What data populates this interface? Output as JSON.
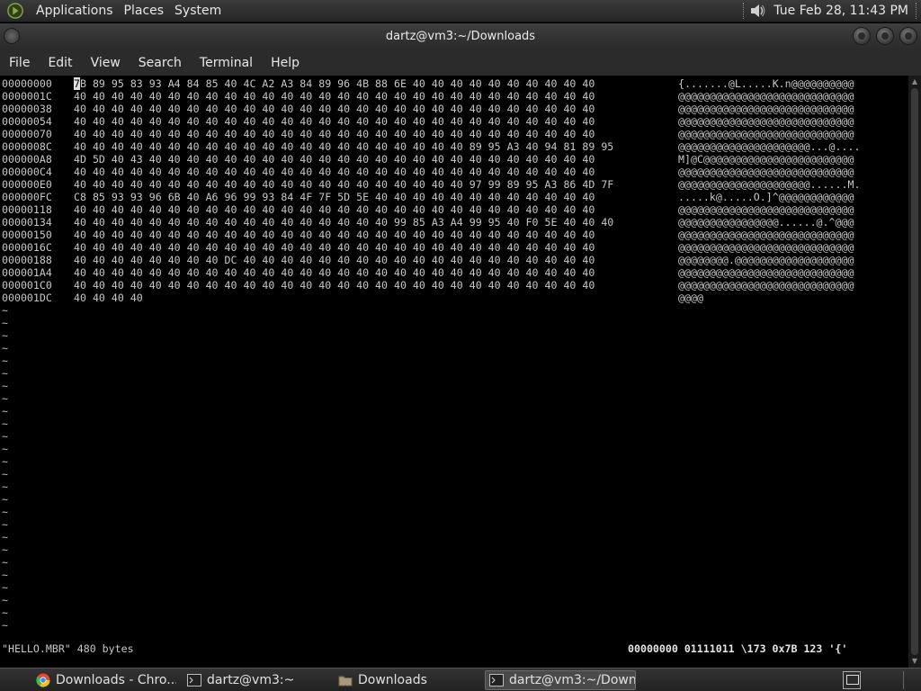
{
  "top_panel": {
    "menus": [
      "Applications",
      "Places",
      "System"
    ],
    "clock": "Tue Feb 28, 11:43 PM",
    "volume_icon": "speaker-icon",
    "logo_icon": "distro-logo-icon"
  },
  "window": {
    "title": "dartz@vm3:~/Downloads",
    "buttons": [
      "minimize-icon",
      "maximize-icon",
      "close-icon"
    ]
  },
  "menubar": {
    "items": [
      "File",
      "Edit",
      "View",
      "Search",
      "Terminal",
      "Help"
    ]
  },
  "hexdump": {
    "cursor_char": "7",
    "first_row_hex_rest": "B 89 95 83 93 A4 84 85 40 4C A2 A3 84 89 96 4B 88 6E 40 40 40 40 40 40 40 40 40 40",
    "rows": [
      {
        "addr": "00000000",
        "hex": "7B 89 95 83 93 A4 84 85 40 4C A2 A3 84 89 96 4B 88 6E 40 40 40 40 40 40 40 40 40 40",
        "ascii": "{.......@L.....K.n@@@@@@@@@@"
      },
      {
        "addr": "0000001C",
        "hex": "40 40 40 40 40 40 40 40 40 40 40 40 40 40 40 40 40 40 40 40 40 40 40 40 40 40 40 40",
        "ascii": "@@@@@@@@@@@@@@@@@@@@@@@@@@@@"
      },
      {
        "addr": "00000038",
        "hex": "40 40 40 40 40 40 40 40 40 40 40 40 40 40 40 40 40 40 40 40 40 40 40 40 40 40 40 40",
        "ascii": "@@@@@@@@@@@@@@@@@@@@@@@@@@@@"
      },
      {
        "addr": "00000054",
        "hex": "40 40 40 40 40 40 40 40 40 40 40 40 40 40 40 40 40 40 40 40 40 40 40 40 40 40 40 40",
        "ascii": "@@@@@@@@@@@@@@@@@@@@@@@@@@@@"
      },
      {
        "addr": "00000070",
        "hex": "40 40 40 40 40 40 40 40 40 40 40 40 40 40 40 40 40 40 40 40 40 40 40 40 40 40 40 40",
        "ascii": "@@@@@@@@@@@@@@@@@@@@@@@@@@@@"
      },
      {
        "addr": "0000008C",
        "hex": "40 40 40 40 40 40 40 40 40 40 40 40 40 40 40 40 40 40 40 40 40 89 95 A3 40 94 81 89 95",
        "ascii": "@@@@@@@@@@@@@@@@@@@@@...@...."
      },
      {
        "addr": "000000A8",
        "hex": "4D 5D 40 43 40 40 40 40 40 40 40 40 40 40 40 40 40 40 40 40 40 40 40 40 40 40 40 40",
        "ascii": "M]@C@@@@@@@@@@@@@@@@@@@@@@@@"
      },
      {
        "addr": "000000C4",
        "hex": "40 40 40 40 40 40 40 40 40 40 40 40 40 40 40 40 40 40 40 40 40 40 40 40 40 40 40 40",
        "ascii": "@@@@@@@@@@@@@@@@@@@@@@@@@@@@"
      },
      {
        "addr": "000000E0",
        "hex": "40 40 40 40 40 40 40 40 40 40 40 40 40 40 40 40 40 40 40 40 40 97 99 89 95 A3 86 4D 7F",
        "ascii": "@@@@@@@@@@@@@@@@@@@@@......M."
      },
      {
        "addr": "000000FC",
        "hex": "C8 85 93 93 96 6B 40 A6 96 99 93 84 4F 7F 5D 5E 40 40 40 40 40 40 40 40 40 40 40 40",
        "ascii": ".....k@.....O.]^@@@@@@@@@@@@"
      },
      {
        "addr": "00000118",
        "hex": "40 40 40 40 40 40 40 40 40 40 40 40 40 40 40 40 40 40 40 40 40 40 40 40 40 40 40 40",
        "ascii": "@@@@@@@@@@@@@@@@@@@@@@@@@@@@"
      },
      {
        "addr": "00000134",
        "hex": "40 40 40 40 40 40 40 40 40 40 40 40 40 40 40 40 40 99 85 A3 A4 99 95 40 F0 5E 40 40 40",
        "ascii": "@@@@@@@@@@@@@@@@......@.^@@@"
      },
      {
        "addr": "00000150",
        "hex": "40 40 40 40 40 40 40 40 40 40 40 40 40 40 40 40 40 40 40 40 40 40 40 40 40 40 40 40",
        "ascii": "@@@@@@@@@@@@@@@@@@@@@@@@@@@@"
      },
      {
        "addr": "0000016C",
        "hex": "40 40 40 40 40 40 40 40 40 40 40 40 40 40 40 40 40 40 40 40 40 40 40 40 40 40 40 40",
        "ascii": "@@@@@@@@@@@@@@@@@@@@@@@@@@@@"
      },
      {
        "addr": "00000188",
        "hex": "40 40 40 40 40 40 40 40 DC 40 40 40 40 40 40 40 40 40 40 40 40 40 40 40 40 40 40 40",
        "ascii": "@@@@@@@@.@@@@@@@@@@@@@@@@@@@"
      },
      {
        "addr": "000001A4",
        "hex": "40 40 40 40 40 40 40 40 40 40 40 40 40 40 40 40 40 40 40 40 40 40 40 40 40 40 40 40",
        "ascii": "@@@@@@@@@@@@@@@@@@@@@@@@@@@@"
      },
      {
        "addr": "000001C0",
        "hex": "40 40 40 40 40 40 40 40 40 40 40 40 40 40 40 40 40 40 40 40 40 40 40 40 40 40 40 40",
        "ascii": "@@@@@@@@@@@@@@@@@@@@@@@@@@@@"
      },
      {
        "addr": "000001DC",
        "hex": "40 40 40 40",
        "ascii": "@@@@"
      }
    ],
    "tilde": "~"
  },
  "status": {
    "left": "\"HELLO.MBR\" 480 bytes",
    "right": "00000000 01111011 \\173 0x7B 123 '{'"
  },
  "taskbar": {
    "tasks": [
      {
        "label": "Downloads - Chro...",
        "icon": "chrome-icon"
      },
      {
        "label": "dartz@vm3:~",
        "icon": "terminal-icon"
      },
      {
        "label": "Downloads",
        "icon": "folder-icon"
      },
      {
        "label": "dartz@vm3:~/Down...",
        "icon": "terminal-icon",
        "active": true
      }
    ],
    "show_desktop_icon": "show-desktop-icon"
  }
}
